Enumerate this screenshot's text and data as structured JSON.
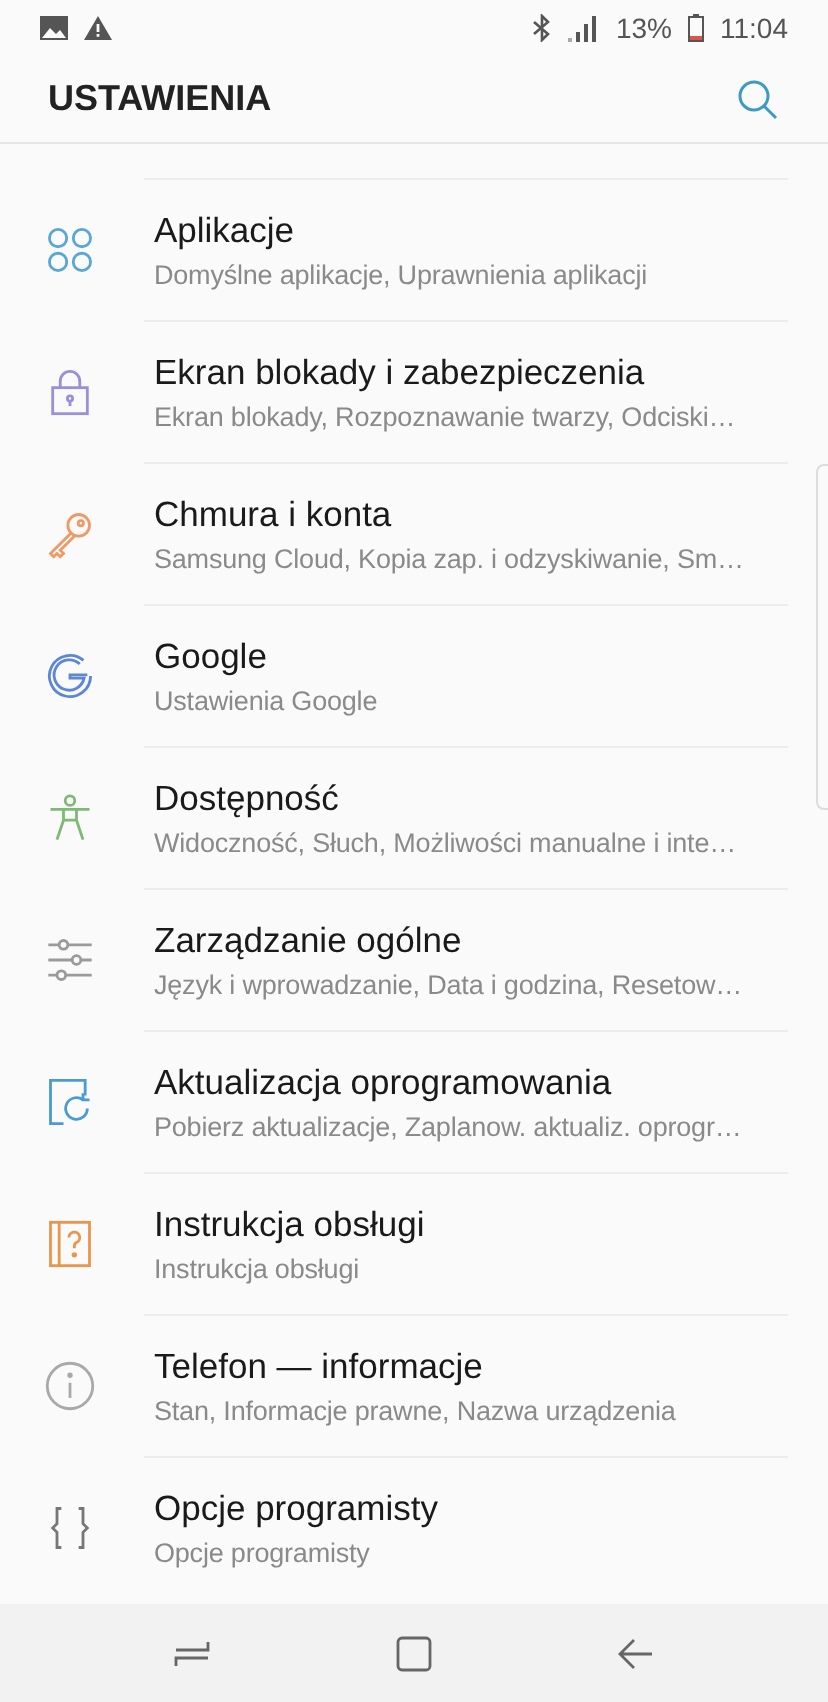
{
  "status_bar": {
    "percent": "13%",
    "time": "11:04"
  },
  "header": {
    "title": "USTAWIENIA"
  },
  "items": [
    {
      "title": "Aplikacje",
      "subtitle": "Domyślne aplikacje, Uprawnienia aplikacji",
      "kind": "apps",
      "color": "#5aa7d6"
    },
    {
      "title": "Ekran blokady i zabezpieczenia",
      "subtitle": "Ekran blokady, Rozpoznawanie twarzy, Odciski…",
      "kind": "lock",
      "color": "#9a8fd8"
    },
    {
      "title": "Chmura i konta",
      "subtitle": "Samsung Cloud, Kopia zap. i odzyskiwanie, Sm…",
      "kind": "key",
      "color": "#ee9a66"
    },
    {
      "title": "Google",
      "subtitle": "Ustawienia Google",
      "kind": "google",
      "color": "#5c86d6"
    },
    {
      "title": "Dostępność",
      "subtitle": "Widoczność, Słuch, Możliwości manualne i inte…",
      "kind": "person",
      "color": "#7dbb74"
    },
    {
      "title": "Zarządzanie ogólne",
      "subtitle": "Język i wprowadzanie, Data i godzina, Resetow…",
      "kind": "sliders",
      "color": "#9a9a9a"
    },
    {
      "title": "Aktualizacja oprogramowania",
      "subtitle": "Pobierz aktualizacje, Zaplanow. aktualiz. oprogr…",
      "kind": "update",
      "color": "#4a9ad6"
    },
    {
      "title": "Instrukcja obsługi",
      "subtitle": "Instrukcja obsługi",
      "kind": "manual",
      "color": "#e8964e"
    },
    {
      "title": "Telefon — informacje",
      "subtitle": "Stan, Informacje prawne, Nazwa urządzenia",
      "kind": "info",
      "color": "#a9a9a9"
    },
    {
      "title": "Opcje programisty",
      "subtitle": "Opcje programisty",
      "kind": "braces",
      "color": "#777777"
    }
  ]
}
